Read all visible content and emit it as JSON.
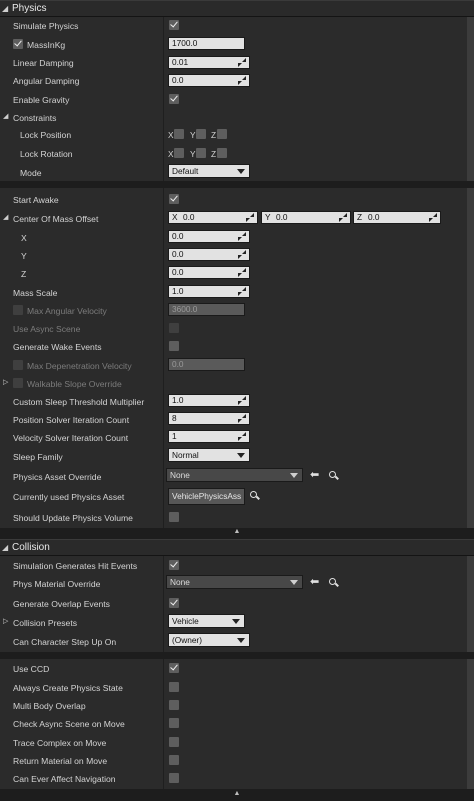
{
  "physics": {
    "header": "Physics",
    "simulate_physics": "Simulate Physics",
    "mass_in_kg": "MassInKg",
    "mass_in_kg_value": "1700.0",
    "linear_damping": "Linear Damping",
    "linear_damping_value": "0.01",
    "angular_damping": "Angular Damping",
    "angular_damping_value": "0.0",
    "enable_gravity": "Enable Gravity",
    "constraints": "Constraints",
    "lock_position": "Lock Position",
    "lock_rotation": "Lock Rotation",
    "mode": "Mode",
    "mode_value": "Default",
    "axis_x": "X",
    "axis_y": "Y",
    "axis_z": "Z",
    "start_awake": "Start Awake",
    "center_of_mass_offset": "Center Of Mass Offset",
    "com_x_value": "0.0",
    "com_y_value": "0.0",
    "com_z_value": "0.0",
    "com_x_label": "X",
    "com_y_label": "Y",
    "com_z_label": "Z",
    "x_row_value": "0.0",
    "y_row_value": "0.0",
    "z_row_value": "0.0",
    "mass_scale": "Mass Scale",
    "mass_scale_value": "1.0",
    "max_angular_velocity": "Max Angular Velocity",
    "max_angular_velocity_value": "3600.0",
    "use_async_scene": "Use Async Scene",
    "generate_wake_events": "Generate Wake Events",
    "max_depenetration_velocity": "Max Depenetration Velocity",
    "max_depenetration_velocity_value": "0.0",
    "walkable_slope_override": "Walkable Slope Override",
    "custom_sleep_threshold": "Custom Sleep Threshold Multiplier",
    "custom_sleep_threshold_value": "1.0",
    "position_solver": "Position Solver Iteration Count",
    "position_solver_value": "8",
    "velocity_solver": "Velocity Solver Iteration Count",
    "velocity_solver_value": "1",
    "sleep_family": "Sleep Family",
    "sleep_family_value": "Normal",
    "physics_asset_override": "Physics Asset Override",
    "physics_asset_override_value": "None",
    "currently_used_physics_asset": "Currently used Physics Asset",
    "currently_used_physics_asset_value": "VehiclePhysicsAss",
    "should_update_physics_volume": "Should Update Physics Volume"
  },
  "collision": {
    "header": "Collision",
    "sim_generates_hit_events": "Simulation Generates Hit Events",
    "phys_material_override": "Phys Material Override",
    "phys_material_override_value": "None",
    "generate_overlap_events": "Generate Overlap Events",
    "collision_presets": "Collision Presets",
    "collision_presets_value": "Vehicle",
    "can_character_step_up_on": "Can Character Step Up On",
    "can_character_step_up_on_value": "(Owner)",
    "use_ccd": "Use CCD",
    "always_create_physics_state": "Always Create Physics State",
    "multi_body_overlap": "Multi Body Overlap",
    "check_async_scene_on_move": "Check Async Scene on Move",
    "trace_complex_on_move": "Trace Complex on Move",
    "return_material_on_move": "Return Material on Move",
    "can_ever_affect_navigation": "Can Ever Affect Navigation"
  },
  "icons": {
    "collapse": "collapse-arrow-icon",
    "use_selected": "left-arrow-icon",
    "browse": "search-icon"
  }
}
